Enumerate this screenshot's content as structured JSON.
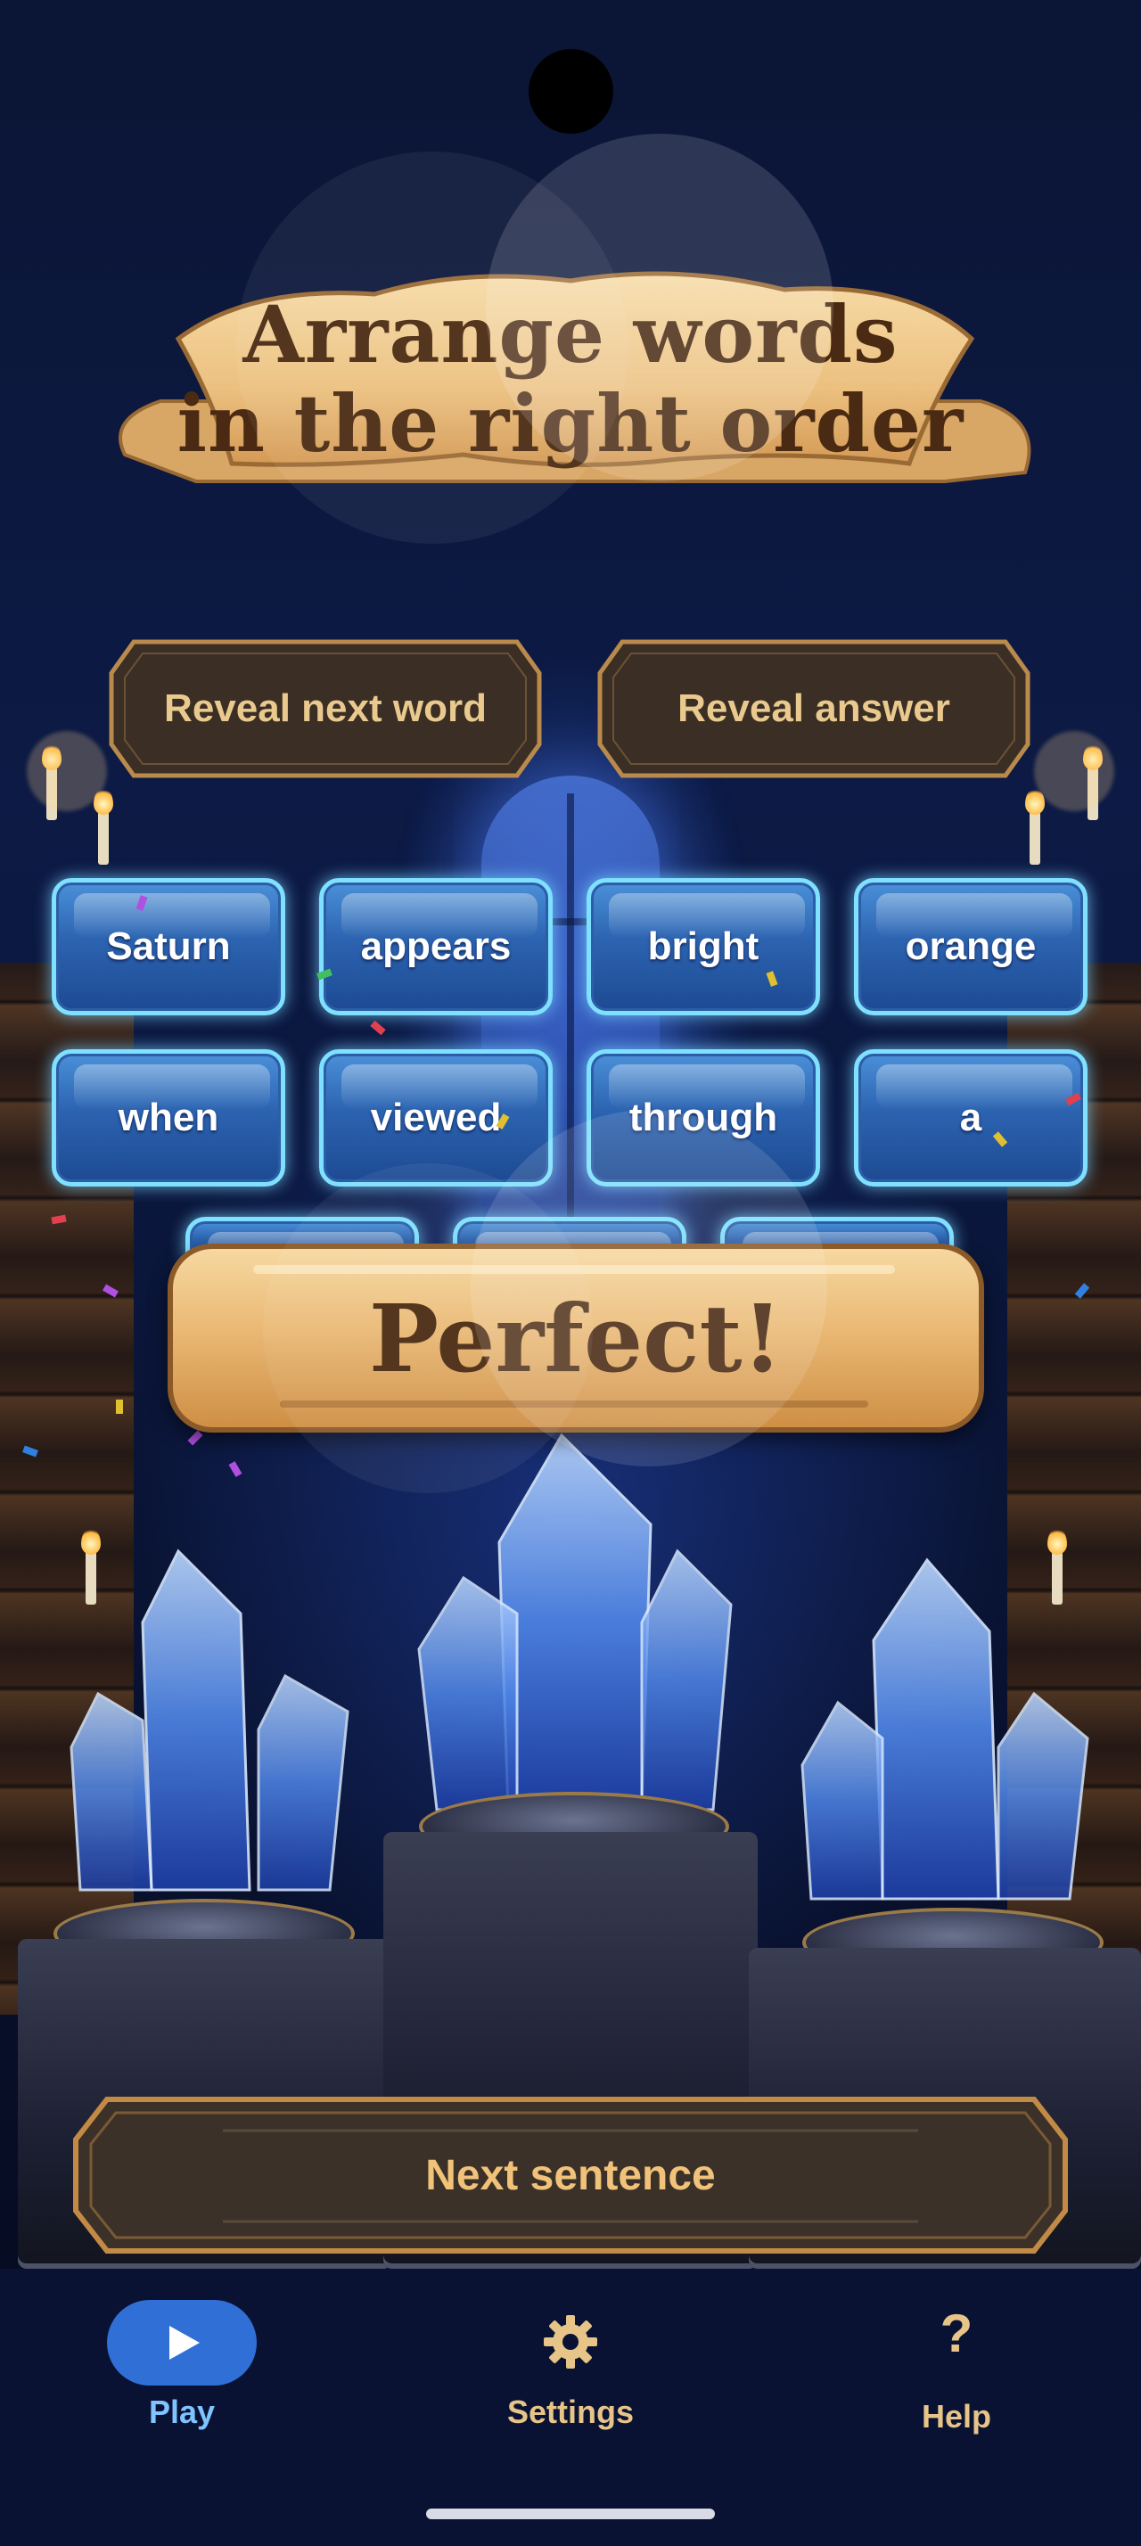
{
  "title": {
    "line1": "Arrange words",
    "line2": "in the right order"
  },
  "hints": {
    "reveal_next_word": "Reveal next word",
    "reveal_answer": "Reveal answer"
  },
  "words": {
    "row1": [
      "Saturn",
      "appears",
      "bright",
      "orange"
    ],
    "row2": [
      "when",
      "viewed",
      "through",
      "a"
    ]
  },
  "feedback": {
    "message": "Perfect!"
  },
  "next_sentence": "Next sentence",
  "nav": {
    "play": {
      "label": "Play",
      "icon": "play-icon",
      "active": true
    },
    "settings": {
      "label": "Settings",
      "icon": "gear-icon"
    },
    "help": {
      "label": "Help",
      "icon": "question-mark-icon"
    }
  },
  "colors": {
    "accent": "#2f6fd6",
    "nav_active_text": "#7fc4ff",
    "nav_text": "#e7c488",
    "tile_border": "#7fe0ff",
    "banner_text": "#4a2a12"
  }
}
